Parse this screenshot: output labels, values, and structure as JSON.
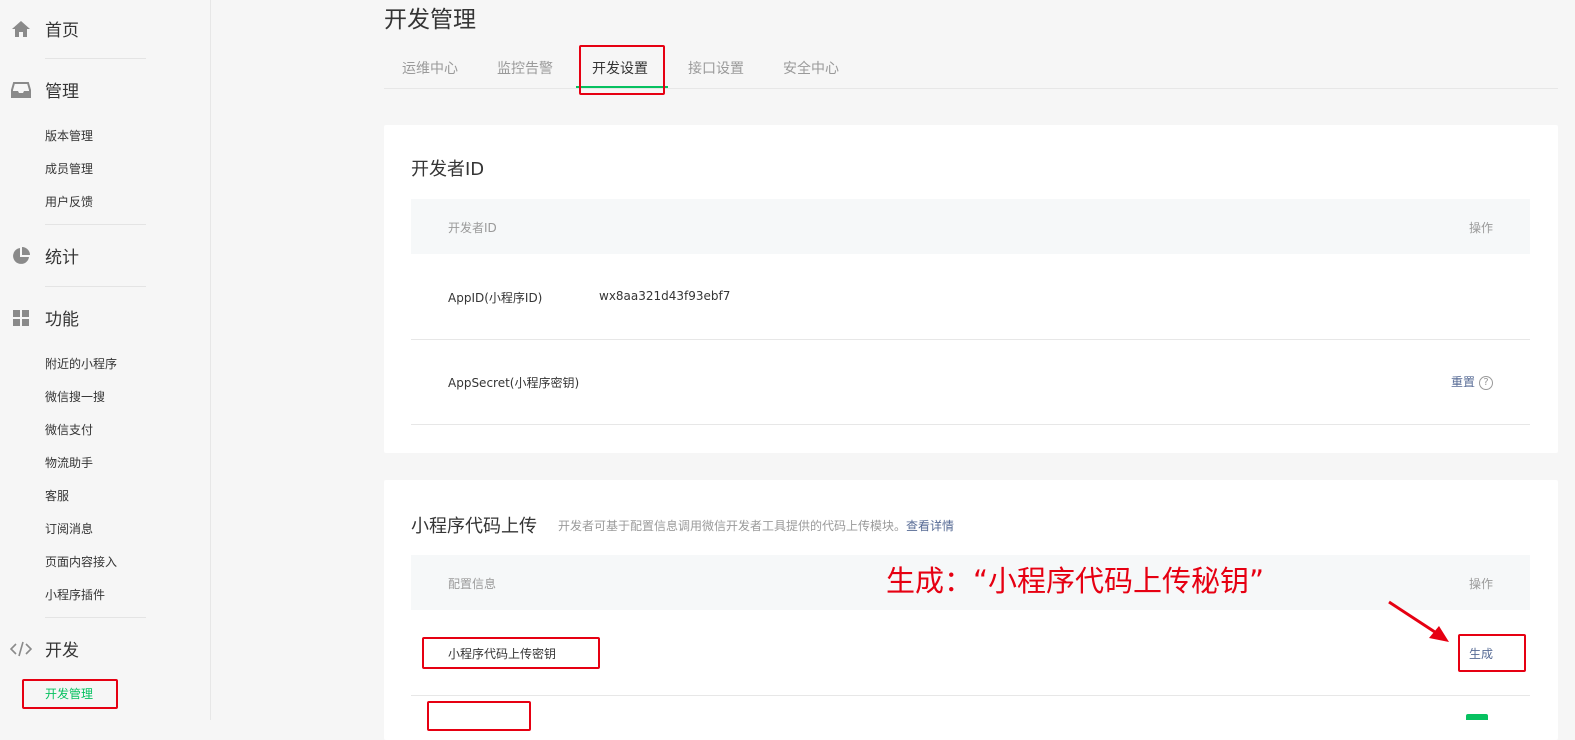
{
  "sidebar": {
    "home": {
      "label": "首页",
      "icon": "home-icon"
    },
    "manage": {
      "label": "管理",
      "icon": "inbox-icon",
      "items": [
        "版本管理",
        "成员管理",
        "用户反馈"
      ]
    },
    "stats": {
      "label": "统计",
      "icon": "pie-chart-icon"
    },
    "features": {
      "label": "功能",
      "icon": "grid-icon",
      "items": [
        "附近的小程序",
        "微信搜一搜",
        "微信支付",
        "物流助手",
        "客服",
        "订阅消息",
        "页面内容接入",
        "小程序插件"
      ]
    },
    "develop": {
      "label": "开发",
      "icon": "code-icon",
      "items": [
        "开发管理"
      ]
    }
  },
  "main": {
    "title": "开发管理",
    "tabs": [
      "运维中心",
      "监控告警",
      "开发设置",
      "接口设置",
      "安全中心"
    ],
    "active_tab": "开发设置"
  },
  "developer_id": {
    "title": "开发者ID",
    "columns": [
      "开发者ID",
      "操作"
    ],
    "rows": [
      {
        "label": "AppID(小程序ID)",
        "value": "wx8aa321d43f93ebf7"
      },
      {
        "label": "AppSecret(小程序密钥)",
        "action": "重置",
        "help": "?"
      }
    ]
  },
  "code_upload": {
    "title": "小程序代码上传",
    "desc": "开发者可基于配置信息调用微信开发者工具提供的代码上传模块。",
    "link": "查看详情",
    "columns": [
      "配置信息",
      "操作"
    ],
    "rows": [
      {
        "label": "小程序代码上传密钥",
        "action": "生成"
      }
    ]
  },
  "annotation": {
    "text": "生成：“小程序代码上传秘钥”"
  },
  "colors": {
    "accent": "#07c160",
    "link": "#576b95",
    "annotation_red": "#e60012"
  }
}
